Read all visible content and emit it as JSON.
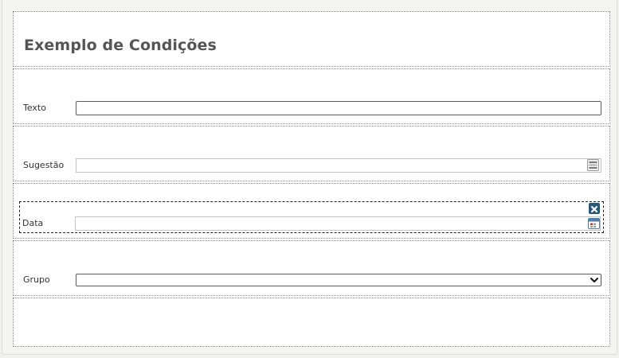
{
  "form": {
    "title": "Exemplo de Condições",
    "fields": [
      {
        "label": "Texto",
        "type": "text",
        "value": ""
      },
      {
        "label": "Sugestão",
        "type": "suggest",
        "value": "",
        "icon": "list-picker-icon"
      },
      {
        "label": "Data",
        "type": "date",
        "value": "",
        "icon": "calendar-icon"
      },
      {
        "label": "Grupo",
        "type": "select",
        "value": "",
        "icon": "chevron-down-icon"
      }
    ],
    "selected_field": "Data"
  },
  "colors": {
    "accent": "#27587a",
    "title": "#555555",
    "section_border": "#8a8a8a"
  }
}
